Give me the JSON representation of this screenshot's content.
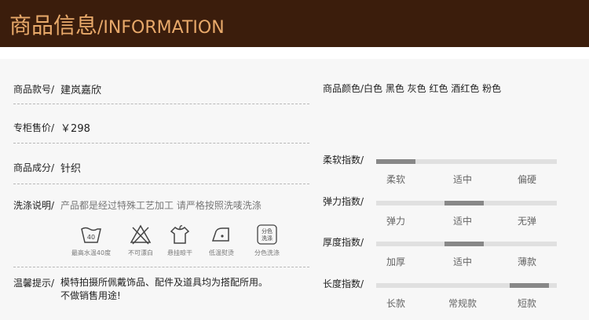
{
  "header": {
    "title": "商品信息",
    "subtitle": "/INFORMATION"
  },
  "info": {
    "model_label": "商品款号/",
    "model_value": "建岚嘉欣",
    "price_label": "专柜售价/",
    "price_value": "￥298",
    "material_label": "商品成分/",
    "material_value": "针织",
    "wash_label": "洗涤说明/",
    "wash_value": "产品都是经过特殊工艺加工 请严格按照洗唛洗涤",
    "notice_label": "温馨提示/",
    "notice_line1": "模特拍摄所佩戴饰品、配件及道具均为搭配所用。",
    "notice_line2": "不做销售用途!"
  },
  "care_icons": [
    {
      "icon": "wash-40-icon",
      "caption": "最高水温40度",
      "text": "40"
    },
    {
      "icon": "no-bleach-icon",
      "caption": "不可漂白"
    },
    {
      "icon": "hang-dry-icon",
      "caption": "悬挂晾干"
    },
    {
      "icon": "low-iron-icon",
      "caption": "低温熨烫"
    },
    {
      "icon": "separate-wash-icon",
      "caption": "分色洗涤",
      "text_line1": "分色",
      "text_line2": "洗涤"
    }
  ],
  "colors": {
    "label": "商品颜色/",
    "options": "白色 黑色 灰色 红色 酒红色 粉色"
  },
  "scales": [
    {
      "label": "柔软指数/",
      "options": [
        "柔软",
        "适中",
        "偏硬"
      ],
      "selected_index": 0
    },
    {
      "label": "弹力指数/",
      "options": [
        "弹力",
        "适中",
        "无弹"
      ],
      "selected_index": 1
    },
    {
      "label": "厚度指数/",
      "options": [
        "加厚",
        "适中",
        "薄款"
      ],
      "selected_index": 1
    },
    {
      "label": "长度指数/",
      "options": [
        "长款",
        "常规款",
        "短款"
      ],
      "selected_index": 2
    }
  ],
  "colors_accent": {
    "header_bg": "#3b1d0c",
    "header_text": "#e8a96a",
    "track": "#e0e0e0",
    "thumb": "#888888"
  }
}
